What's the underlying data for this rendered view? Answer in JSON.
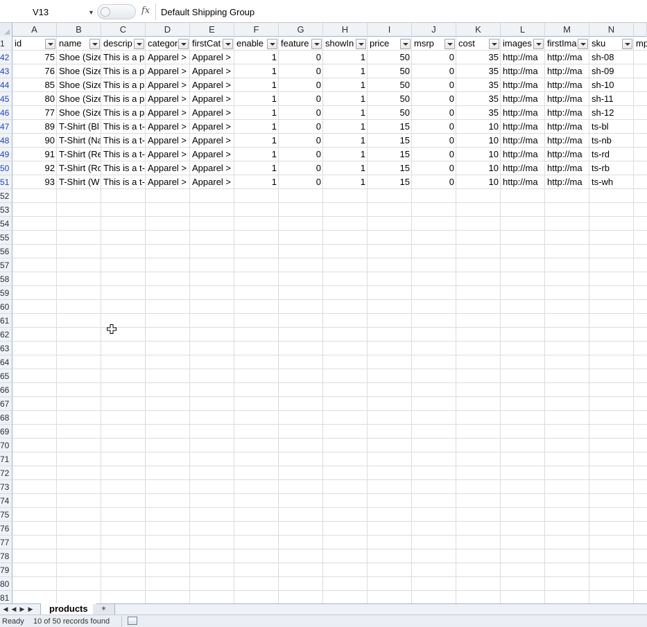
{
  "formula_bar": {
    "name_box": "V13",
    "fx_label": "fx",
    "content": "Default Shipping Group"
  },
  "columns": [
    "A",
    "B",
    "C",
    "D",
    "E",
    "F",
    "G",
    "H",
    "I",
    "J",
    "K",
    "L",
    "M",
    "N"
  ],
  "header_row_number": "1",
  "headers": [
    "id",
    "name",
    "descrip",
    "categor",
    "firstCat",
    "enable",
    "feature",
    "showIn",
    "price",
    "msrp",
    "cost",
    "images",
    "firstIma",
    "sku"
  ],
  "header_extra": "mp",
  "rows": [
    {
      "row": "42",
      "cells": [
        "75",
        "Shoe (Size",
        "This is a pa",
        "Apparel >",
        "Apparel >",
        "1",
        "0",
        "1",
        "50",
        "0",
        "35",
        "http://ma",
        "http://ma",
        "sh-08"
      ]
    },
    {
      "row": "43",
      "cells": [
        "76",
        "Shoe (Size",
        "This is a pa",
        "Apparel >",
        "Apparel >",
        "1",
        "0",
        "1",
        "50",
        "0",
        "35",
        "http://ma",
        "http://ma",
        "sh-09"
      ]
    },
    {
      "row": "44",
      "cells": [
        "85",
        "Shoe (Size",
        "This is a pa",
        "Apparel >",
        "Apparel >",
        "1",
        "0",
        "1",
        "50",
        "0",
        "35",
        "http://ma",
        "http://ma",
        "sh-10"
      ]
    },
    {
      "row": "45",
      "cells": [
        "80",
        "Shoe (Size",
        "This is a pa",
        "Apparel >",
        "Apparel >",
        "1",
        "0",
        "1",
        "50",
        "0",
        "35",
        "http://ma",
        "http://ma",
        "sh-11"
      ]
    },
    {
      "row": "46",
      "cells": [
        "77",
        "Shoe (Size",
        "This is a pa",
        "Apparel >",
        "Apparel >",
        "1",
        "0",
        "1",
        "50",
        "0",
        "35",
        "http://ma",
        "http://ma",
        "sh-12"
      ]
    },
    {
      "row": "47",
      "cells": [
        "89",
        "T-Shirt (Bl",
        "This is a t-",
        "Apparel >",
        "Apparel >",
        "1",
        "0",
        "1",
        "15",
        "0",
        "10",
        "http://ma",
        "http://ma",
        "ts-bl"
      ]
    },
    {
      "row": "48",
      "cells": [
        "90",
        "T-Shirt (Na",
        "This is a t-",
        "Apparel >",
        "Apparel >",
        "1",
        "0",
        "1",
        "15",
        "0",
        "10",
        "http://ma",
        "http://ma",
        "ts-nb"
      ]
    },
    {
      "row": "49",
      "cells": [
        "91",
        "T-Shirt (Re",
        "This is a t-",
        "Apparel >",
        "Apparel >",
        "1",
        "0",
        "1",
        "15",
        "0",
        "10",
        "http://ma",
        "http://ma",
        "ts-rd"
      ]
    },
    {
      "row": "50",
      "cells": [
        "92",
        "T-Shirt (Ro",
        "This is a t-",
        "Apparel >",
        "Apparel >",
        "1",
        "0",
        "1",
        "15",
        "0",
        "10",
        "http://ma",
        "http://ma",
        "ts-rb"
      ]
    },
    {
      "row": "51",
      "cells": [
        "93",
        "T-Shirt (W",
        "This is a t-",
        "Apparel >",
        "Apparel >",
        "1",
        "0",
        "1",
        "15",
        "0",
        "10",
        "http://ma",
        "http://ma",
        "ts-wh"
      ]
    }
  ],
  "empty_rows": [
    "52",
    "53",
    "54",
    "55",
    "56",
    "57",
    "58",
    "59",
    "60",
    "61",
    "62",
    "63",
    "64",
    "65",
    "66",
    "67",
    "68",
    "69",
    "70",
    "71",
    "72",
    "73",
    "74",
    "75",
    "76",
    "77",
    "78",
    "79",
    "80",
    "81"
  ],
  "numeric_columns": [
    0,
    5,
    6,
    7,
    8,
    9,
    10
  ],
  "sheet_tabs": {
    "active": "products"
  },
  "status_bar": {
    "ready": "Ready",
    "records": "10 of 50 records found"
  },
  "icons": {
    "fx": "function-icon",
    "cursor": "cell-select-cursor-icon",
    "new_sheet": "insert-worksheet-icon",
    "status": "page-layout-icon"
  },
  "colors": {
    "filtered_row_number": "#1f46c8",
    "gridline": "#dadcdd",
    "header_bg": "#f0f2f6"
  }
}
